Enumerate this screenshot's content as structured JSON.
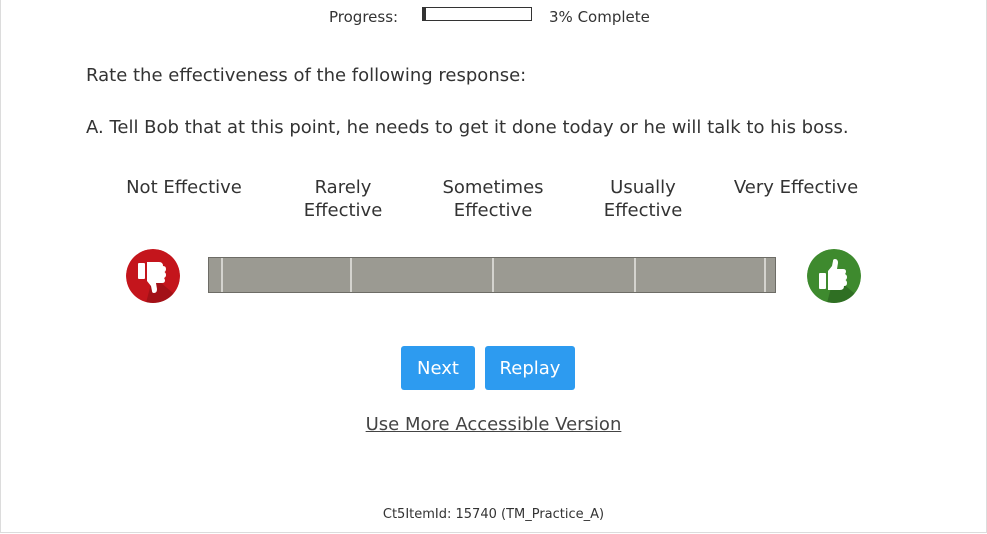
{
  "progress": {
    "label": "Progress:",
    "percent": 3,
    "text": "3% Complete"
  },
  "prompt": "Rate the effectiveness of the following response:",
  "question": "A. Tell Bob that at this point, he needs to get it done today or he will talk to his boss.",
  "scale": {
    "labels": [
      [
        "Not Effective"
      ],
      [
        "Rarely",
        "Effective"
      ],
      [
        "Sometimes",
        "Effective"
      ],
      [
        "Usually",
        "Effective"
      ],
      [
        "Very Effective"
      ]
    ],
    "low_icon": "thumbs-down-icon",
    "high_icon": "thumbs-up-icon"
  },
  "buttons": {
    "next": "Next",
    "replay": "Replay"
  },
  "accessible_link": "Use More Accessible Version",
  "footer": "Ct5ItemId: 15740 (TM_Practice_A)",
  "colors": {
    "button": "#2d9bf0",
    "slider": "#9b9a92",
    "thumbs_down": "#c4151c",
    "thumbs_up": "#3e8a2e"
  }
}
